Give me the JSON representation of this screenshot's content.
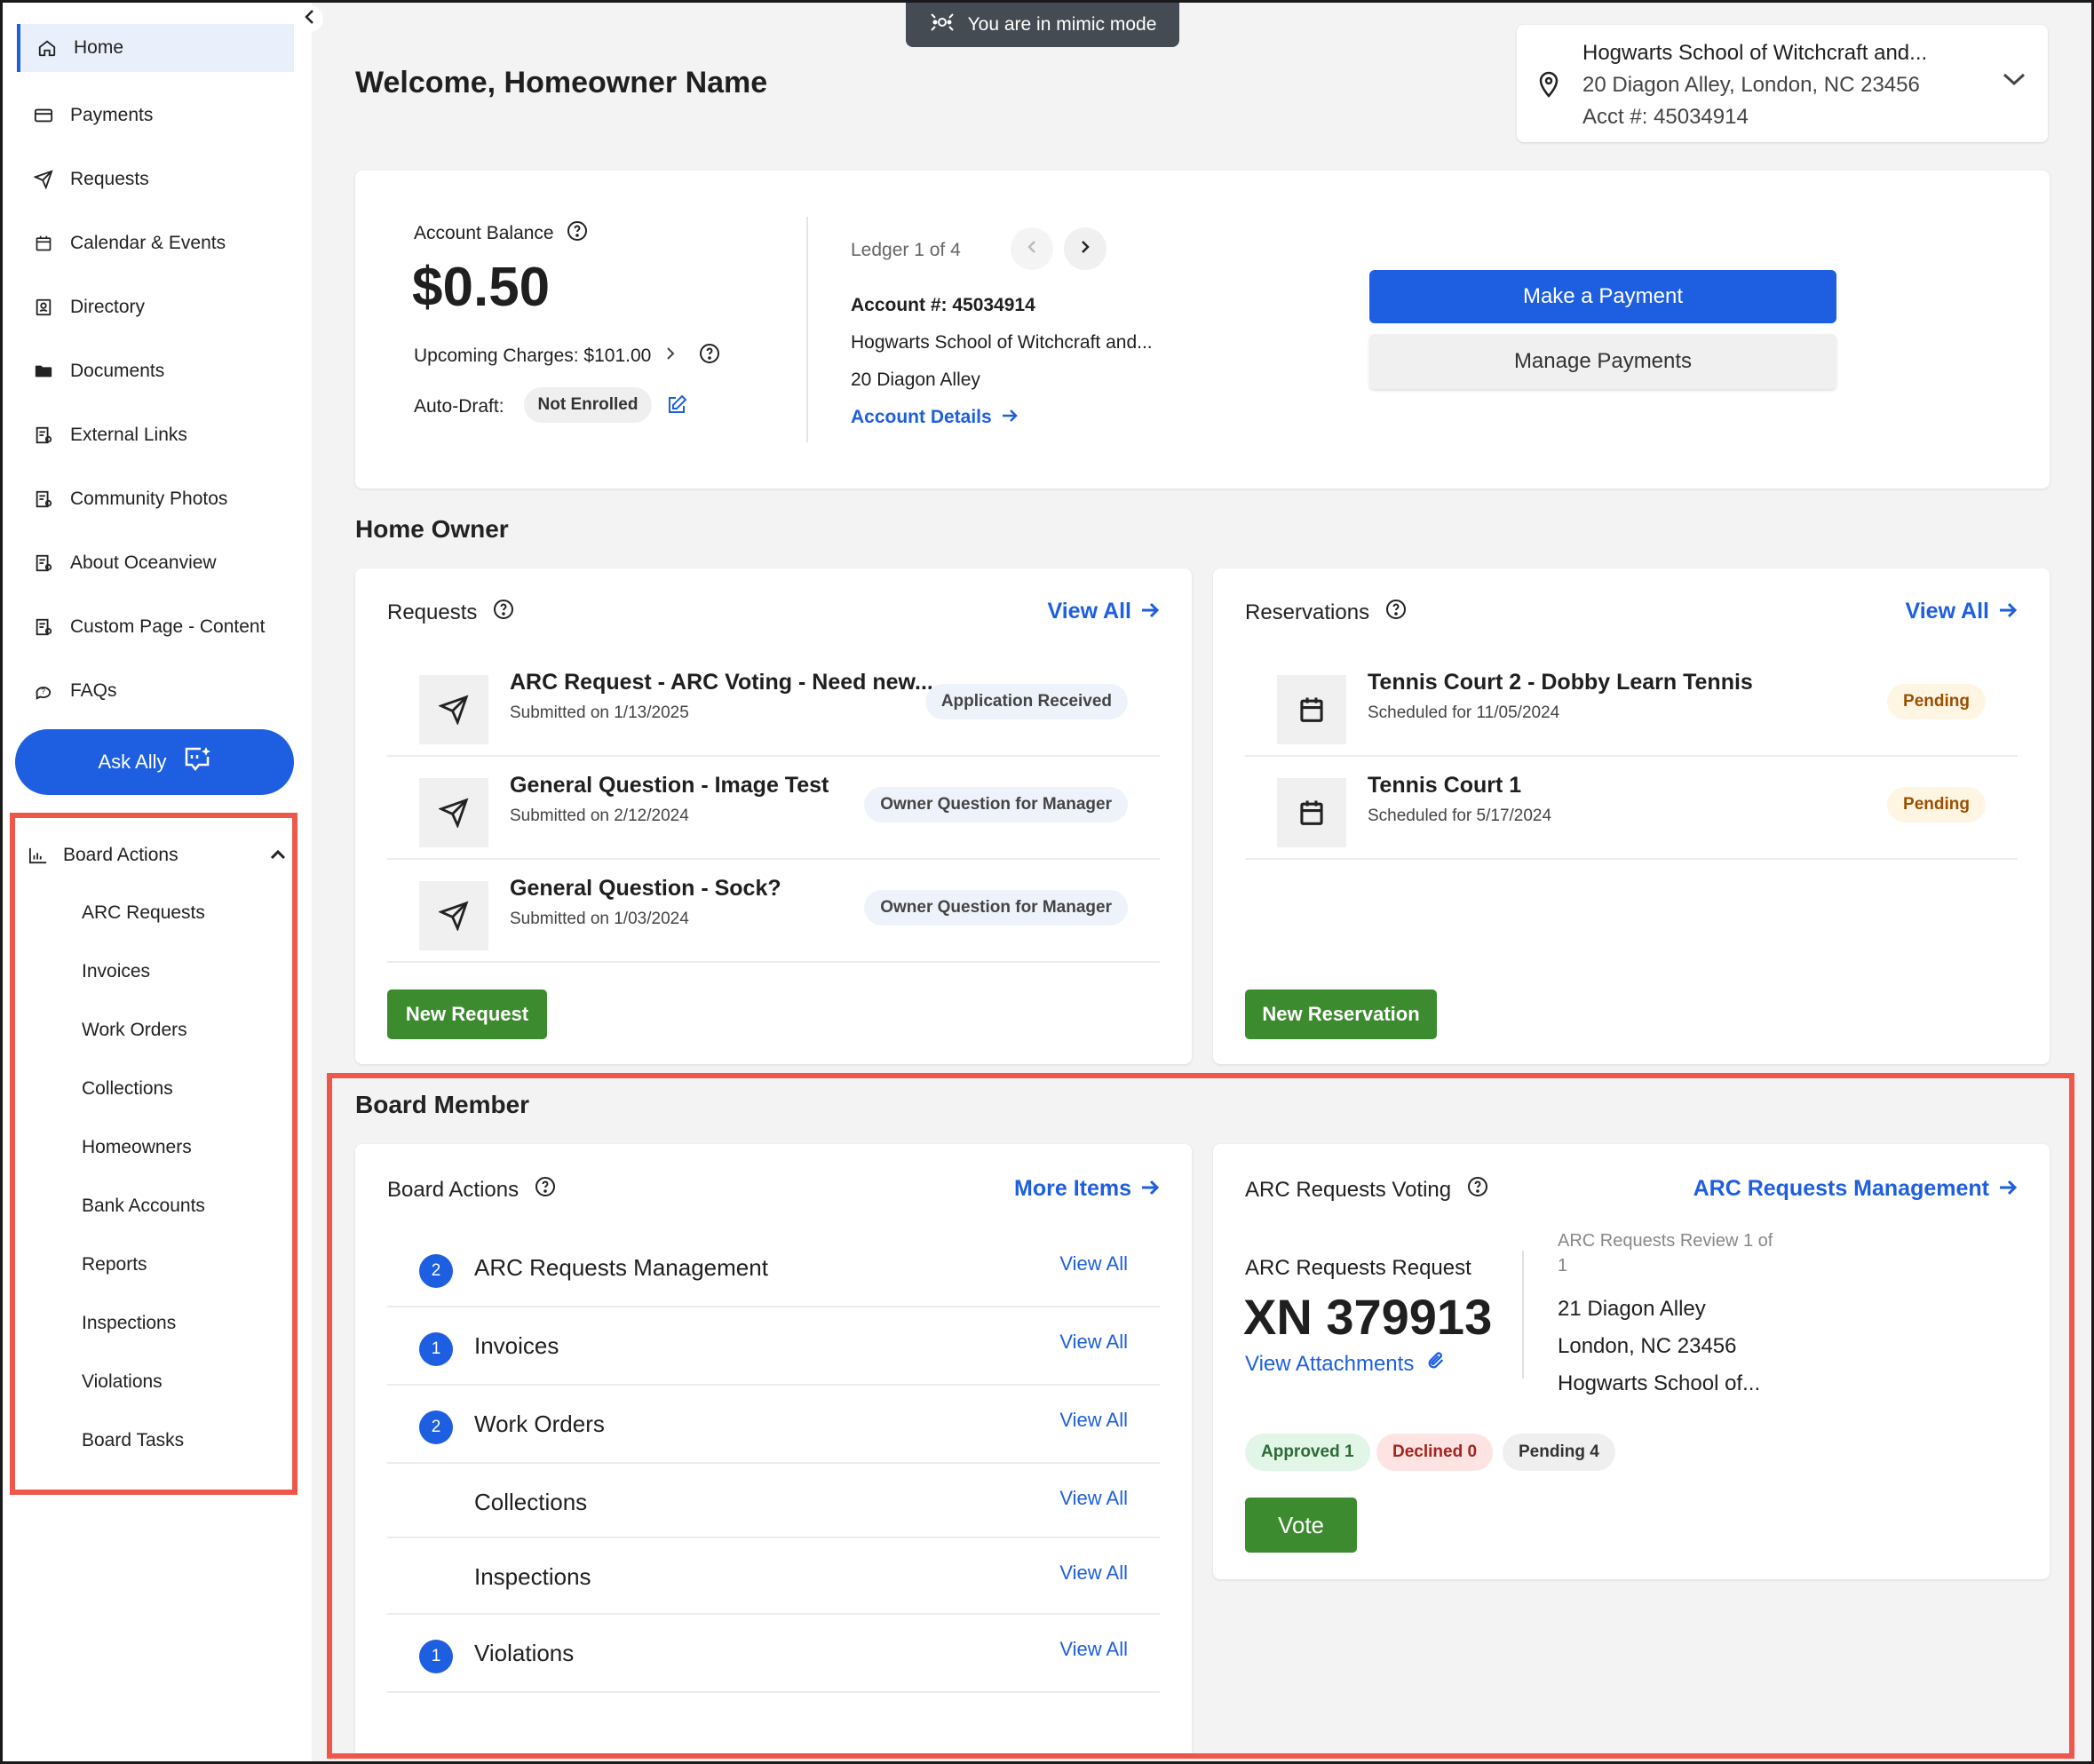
{
  "mimic_banner": "You are in mimic mode",
  "sidebar": {
    "items": [
      {
        "label": "Home",
        "icon": "home-icon"
      },
      {
        "label": "Payments",
        "icon": "credit-card-icon"
      },
      {
        "label": "Requests",
        "icon": "paper-plane-icon"
      },
      {
        "label": "Calendar & Events",
        "icon": "calendar-icon"
      },
      {
        "label": "Directory",
        "icon": "contact-book-icon"
      },
      {
        "label": "Documents",
        "icon": "folder-icon"
      },
      {
        "label": "External Links",
        "icon": "document-link-icon"
      },
      {
        "label": "Community Photos",
        "icon": "document-link-icon"
      },
      {
        "label": "About Oceanview",
        "icon": "document-link-icon"
      },
      {
        "label": "Custom Page - Content",
        "icon": "document-link-icon"
      },
      {
        "label": "FAQs",
        "icon": "faq-icon"
      }
    ],
    "ask_ally": "Ask Ally",
    "board_actions": {
      "label": "Board Actions",
      "items": [
        "ARC Requests",
        "Invoices",
        "Work Orders",
        "Collections",
        "Homeowners",
        "Bank Accounts",
        "Reports",
        "Inspections",
        "Violations",
        "Board Tasks"
      ]
    }
  },
  "header": {
    "welcome": "Welcome, Homeowner Name",
    "account_selector": {
      "name": "Hogwarts School of Witchcraft and...",
      "address": "20 Diagon Alley, London, NC 23456",
      "acct": "Acct #: 45034914"
    }
  },
  "balance": {
    "label": "Account Balance",
    "amount": "$0.50",
    "upcoming": "Upcoming Charges: $101.00",
    "auto_draft_label": "Auto-Draft:",
    "auto_draft_status": "Not Enrolled",
    "ledger": "Ledger 1 of 4",
    "account_number": "Account #: 45034914",
    "account_name": "Hogwarts School of Witchcraft and...",
    "account_address": "20 Diagon Alley",
    "account_details": "Account Details",
    "make_payment": "Make a Payment",
    "manage_payments": "Manage Payments"
  },
  "home_owner": {
    "title": "Home Owner",
    "requests": {
      "title": "Requests",
      "view_all": "View All",
      "rows": [
        {
          "title": "ARC Request - ARC Voting - Need new...",
          "sub": "Submitted on 1/13/2025",
          "badge": "Application Received"
        },
        {
          "title": "General Question - Image Test",
          "sub": "Submitted on 2/12/2024",
          "badge": "Owner Question for Manager"
        },
        {
          "title": "General Question - Sock?",
          "sub": "Submitted on 1/03/2024",
          "badge": "Owner Question for Manager"
        }
      ],
      "new_button": "New Request"
    },
    "reservations": {
      "title": "Reservations",
      "view_all": "View All",
      "rows": [
        {
          "title": "Tennis Court 2 - Dobby Learn Tennis",
          "sub": "Scheduled for 11/05/2024",
          "badge": "Pending"
        },
        {
          "title": "Tennis Court 1",
          "sub": "Scheduled for 5/17/2024",
          "badge": "Pending"
        }
      ],
      "new_button": "New Reservation"
    }
  },
  "board_member": {
    "title": "Board Member",
    "board_actions": {
      "title": "Board Actions",
      "more": "More Items",
      "rows": [
        {
          "count": "2",
          "label": "ARC Requests Management",
          "link": "View All"
        },
        {
          "count": "1",
          "label": "Invoices",
          "link": "View All"
        },
        {
          "count": "2",
          "label": "Work Orders",
          "link": "View All"
        },
        {
          "count": "",
          "label": "Collections",
          "link": "View All"
        },
        {
          "count": "",
          "label": "Inspections",
          "link": "View All"
        },
        {
          "count": "1",
          "label": "Violations",
          "link": "View All"
        }
      ]
    },
    "arc_voting": {
      "title": "ARC Requests Voting",
      "management": "ARC Requests Management",
      "request_label": "ARC Requests Request",
      "request_id": "XN 379913",
      "attachments": "View Attachments",
      "review": "ARC Requests Review 1 of",
      "review_total": "1",
      "addr1": "21 Diagon Alley",
      "addr2": "London, NC 23456",
      "addr3": "Hogwarts School of...",
      "approved": "Approved 1",
      "declined": "Declined 0",
      "pending": "Pending 4",
      "vote": "Vote"
    }
  },
  "colors": {
    "primary": "#1d5fe0",
    "green": "#3d8b2f",
    "highlight": "#f0574b"
  }
}
